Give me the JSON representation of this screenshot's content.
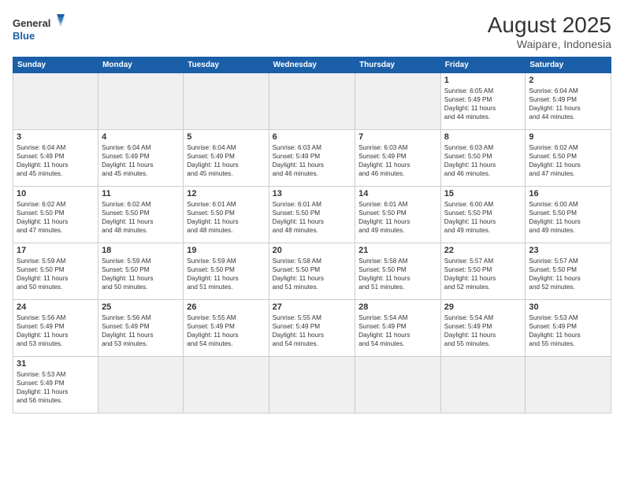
{
  "header": {
    "logo_general": "General",
    "logo_blue": "Blue",
    "month_year": "August 2025",
    "location": "Waipare, Indonesia"
  },
  "days_of_week": [
    "Sunday",
    "Monday",
    "Tuesday",
    "Wednesday",
    "Thursday",
    "Friday",
    "Saturday"
  ],
  "weeks": [
    [
      {
        "day": "",
        "empty": true
      },
      {
        "day": "",
        "empty": true
      },
      {
        "day": "",
        "empty": true
      },
      {
        "day": "",
        "empty": true
      },
      {
        "day": "",
        "empty": true
      },
      {
        "day": "1",
        "sunrise": "6:05 AM",
        "sunset": "5:49 PM",
        "daylight_h": "11",
        "daylight_m": "44"
      },
      {
        "day": "2",
        "sunrise": "6:04 AM",
        "sunset": "5:49 PM",
        "daylight_h": "11",
        "daylight_m": "44"
      }
    ],
    [
      {
        "day": "3",
        "sunrise": "6:04 AM",
        "sunset": "5:49 PM",
        "daylight_h": "11",
        "daylight_m": "45"
      },
      {
        "day": "4",
        "sunrise": "6:04 AM",
        "sunset": "5:49 PM",
        "daylight_h": "11",
        "daylight_m": "45"
      },
      {
        "day": "5",
        "sunrise": "6:04 AM",
        "sunset": "5:49 PM",
        "daylight_h": "11",
        "daylight_m": "45"
      },
      {
        "day": "6",
        "sunrise": "6:03 AM",
        "sunset": "5:49 PM",
        "daylight_h": "11",
        "daylight_m": "46"
      },
      {
        "day": "7",
        "sunrise": "6:03 AM",
        "sunset": "5:49 PM",
        "daylight_h": "11",
        "daylight_m": "46"
      },
      {
        "day": "8",
        "sunrise": "6:03 AM",
        "sunset": "5:50 PM",
        "daylight_h": "11",
        "daylight_m": "46"
      },
      {
        "day": "9",
        "sunrise": "6:02 AM",
        "sunset": "5:50 PM",
        "daylight_h": "11",
        "daylight_m": "47"
      }
    ],
    [
      {
        "day": "10",
        "sunrise": "6:02 AM",
        "sunset": "5:50 PM",
        "daylight_h": "11",
        "daylight_m": "47"
      },
      {
        "day": "11",
        "sunrise": "6:02 AM",
        "sunset": "5:50 PM",
        "daylight_h": "11",
        "daylight_m": "48"
      },
      {
        "day": "12",
        "sunrise": "6:01 AM",
        "sunset": "5:50 PM",
        "daylight_h": "11",
        "daylight_m": "48"
      },
      {
        "day": "13",
        "sunrise": "6:01 AM",
        "sunset": "5:50 PM",
        "daylight_h": "11",
        "daylight_m": "48"
      },
      {
        "day": "14",
        "sunrise": "6:01 AM",
        "sunset": "5:50 PM",
        "daylight_h": "11",
        "daylight_m": "49"
      },
      {
        "day": "15",
        "sunrise": "6:00 AM",
        "sunset": "5:50 PM",
        "daylight_h": "11",
        "daylight_m": "49"
      },
      {
        "day": "16",
        "sunrise": "6:00 AM",
        "sunset": "5:50 PM",
        "daylight_h": "11",
        "daylight_m": "49"
      }
    ],
    [
      {
        "day": "17",
        "sunrise": "5:59 AM",
        "sunset": "5:50 PM",
        "daylight_h": "11",
        "daylight_m": "50"
      },
      {
        "day": "18",
        "sunrise": "5:59 AM",
        "sunset": "5:50 PM",
        "daylight_h": "11",
        "daylight_m": "50"
      },
      {
        "day": "19",
        "sunrise": "5:59 AM",
        "sunset": "5:50 PM",
        "daylight_h": "11",
        "daylight_m": "51"
      },
      {
        "day": "20",
        "sunrise": "5:58 AM",
        "sunset": "5:50 PM",
        "daylight_h": "11",
        "daylight_m": "51"
      },
      {
        "day": "21",
        "sunrise": "5:58 AM",
        "sunset": "5:50 PM",
        "daylight_h": "11",
        "daylight_m": "51"
      },
      {
        "day": "22",
        "sunrise": "5:57 AM",
        "sunset": "5:50 PM",
        "daylight_h": "11",
        "daylight_m": "52"
      },
      {
        "day": "23",
        "sunrise": "5:57 AM",
        "sunset": "5:50 PM",
        "daylight_h": "11",
        "daylight_m": "52"
      }
    ],
    [
      {
        "day": "24",
        "sunrise": "5:56 AM",
        "sunset": "5:49 PM",
        "daylight_h": "11",
        "daylight_m": "53"
      },
      {
        "day": "25",
        "sunrise": "5:56 AM",
        "sunset": "5:49 PM",
        "daylight_h": "11",
        "daylight_m": "53"
      },
      {
        "day": "26",
        "sunrise": "5:55 AM",
        "sunset": "5:49 PM",
        "daylight_h": "11",
        "daylight_m": "54"
      },
      {
        "day": "27",
        "sunrise": "5:55 AM",
        "sunset": "5:49 PM",
        "daylight_h": "11",
        "daylight_m": "54"
      },
      {
        "day": "28",
        "sunrise": "5:54 AM",
        "sunset": "5:49 PM",
        "daylight_h": "11",
        "daylight_m": "54"
      },
      {
        "day": "29",
        "sunrise": "5:54 AM",
        "sunset": "5:49 PM",
        "daylight_h": "11",
        "daylight_m": "55"
      },
      {
        "day": "30",
        "sunrise": "5:53 AM",
        "sunset": "5:49 PM",
        "daylight_h": "11",
        "daylight_m": "55"
      }
    ],
    [
      {
        "day": "31",
        "sunrise": "5:53 AM",
        "sunset": "5:49 PM",
        "daylight_h": "11",
        "daylight_m": "56"
      },
      {
        "day": "",
        "empty": true
      },
      {
        "day": "",
        "empty": true
      },
      {
        "day": "",
        "empty": true
      },
      {
        "day": "",
        "empty": true
      },
      {
        "day": "",
        "empty": true
      },
      {
        "day": "",
        "empty": true
      }
    ]
  ],
  "labels": {
    "sunrise": "Sunrise:",
    "sunset": "Sunset:",
    "daylight": "Daylight: ",
    "hours": " hours",
    "and": "and",
    "minutes": "minutes."
  }
}
